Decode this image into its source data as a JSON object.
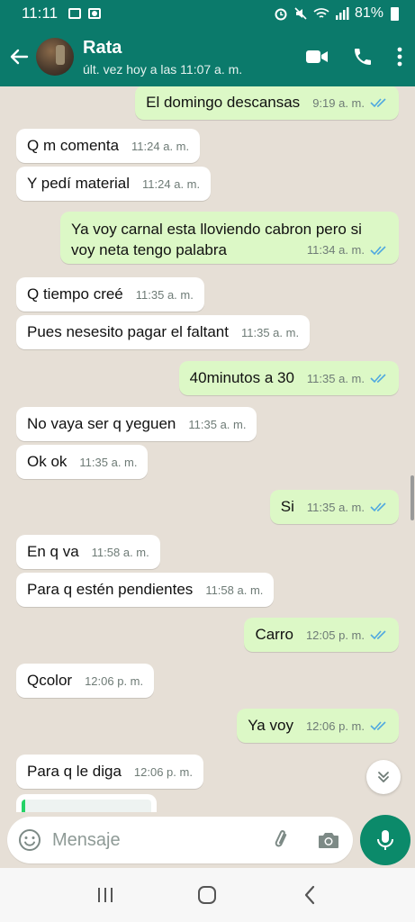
{
  "status_bar": {
    "time": "11:11",
    "battery": "81%"
  },
  "header": {
    "contact_name": "Rata",
    "last_seen": "últ. vez hoy a las 11:07 a. m."
  },
  "colors": {
    "header_bg": "#0b7a6b",
    "outgoing_bubble": "#dcf8c6",
    "incoming_bubble": "#ffffff",
    "read_ticks": "#4fa8e0",
    "mic_button": "#0b8a6a"
  },
  "messages": [
    {
      "direction": "out",
      "text": "El domingo descansas",
      "time": "9:19 a. m.",
      "status": "read"
    },
    {
      "direction": "in",
      "text": "Q m comenta",
      "time": "11:24 a. m."
    },
    {
      "direction": "in",
      "text": "Y pedí material",
      "time": "11:24 a. m."
    },
    {
      "direction": "out",
      "text": "Ya voy carnal esta lloviendo cabron pero si voy neta tengo palabra",
      "time": "11:34 a. m.",
      "status": "read"
    },
    {
      "direction": "in",
      "text": "Q tiempo creé",
      "time": "11:35 a. m."
    },
    {
      "direction": "in",
      "text": "Pues nesesito pagar el faltant",
      "time": "11:35 a. m."
    },
    {
      "direction": "out",
      "text": "40minutos a 30",
      "time": "11:35 a. m.",
      "status": "read"
    },
    {
      "direction": "in",
      "text": "No vaya ser q yeguen",
      "time": "11:35 a. m."
    },
    {
      "direction": "in",
      "text": "Ok ok",
      "time": "11:35 a. m."
    },
    {
      "direction": "out",
      "text": "Si",
      "time": "11:35 a. m.",
      "status": "read"
    },
    {
      "direction": "in",
      "text": "En q va",
      "time": "11:58 a. m."
    },
    {
      "direction": "in",
      "text": "Para q estén pendientes",
      "time": "11:58 a. m."
    },
    {
      "direction": "out",
      "text": "Carro",
      "time": "12:05 p. m.",
      "status": "read"
    },
    {
      "direction": "in",
      "text": "Qcolor",
      "time": "12:06 p. m."
    },
    {
      "direction": "out",
      "text": "Ya voy",
      "time": "12:06 p. m.",
      "status": "read"
    },
    {
      "direction": "in",
      "text": "Para q le diga",
      "time": "12:06 p. m."
    }
  ],
  "composer": {
    "placeholder": "Mensaje"
  },
  "icons": {
    "header": [
      "back-arrow-icon",
      "video-call-icon",
      "phone-icon",
      "more-options-icon"
    ],
    "composer": [
      "emoji-icon",
      "attach-icon",
      "camera-icon",
      "mic-icon"
    ],
    "nav": [
      "recent-apps-icon",
      "home-icon",
      "back-icon"
    ],
    "scroll": "chevron-double-down-icon"
  }
}
